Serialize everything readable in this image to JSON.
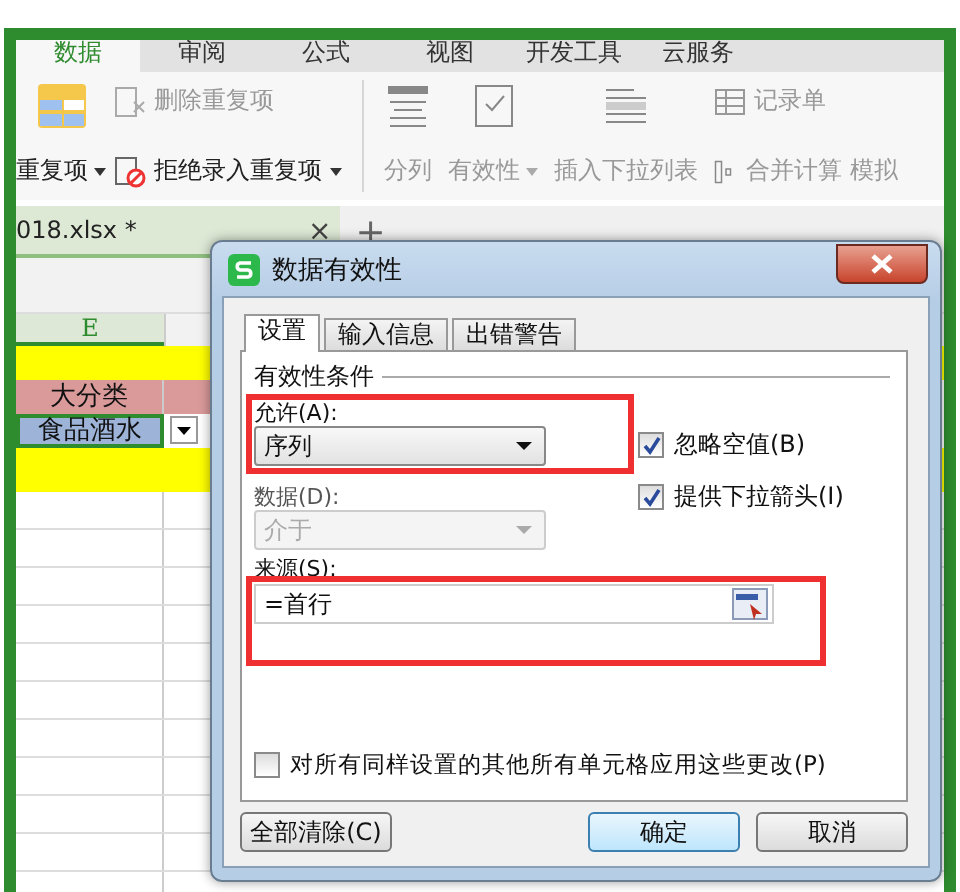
{
  "ribbon_tabs": [
    {
      "label": "数据",
      "selected": true
    },
    {
      "label": "审阅",
      "selected": false
    },
    {
      "label": "公式",
      "selected": false
    },
    {
      "label": "视图",
      "selected": false
    },
    {
      "label": "开发工具",
      "selected": false
    },
    {
      "label": "云服务",
      "selected": false
    }
  ],
  "ribbon": {
    "left": [
      {
        "label": "删除重复项",
        "disabled": true,
        "dropdown": false
      },
      {
        "label": "拒绝录入重复项",
        "disabled": false,
        "dropdown": true
      }
    ],
    "big": {
      "label": "重复项",
      "dropdown": true
    },
    "tools": [
      {
        "label": "分列",
        "kind": "split",
        "dropdown": false
      },
      {
        "label": "有效性",
        "kind": "check",
        "dropdown": true
      },
      {
        "label": "插入下拉列表",
        "kind": "list",
        "dropdown": false
      }
    ],
    "small": [
      {
        "label": "记录单",
        "kind": "form"
      },
      {
        "label": "合并计算",
        "kind": "merge"
      }
    ],
    "cut_label": "模拟"
  },
  "file_tab": {
    "name": "018.xlsx *",
    "close": "×",
    "add": "+"
  },
  "sheet": {
    "column": "E",
    "header_cell": "大分类",
    "active_cell": "食品酒水"
  },
  "dialog": {
    "title": "数据有效性",
    "tabs": [
      {
        "label": "设置",
        "selected": true
      },
      {
        "label": "输入信息",
        "selected": false
      },
      {
        "label": "出错警告",
        "selected": false
      }
    ],
    "section": "有效性条件",
    "allow": {
      "label": "允许(A):",
      "value": "序列",
      "disabled": false
    },
    "data": {
      "label": "数据(D):",
      "value": "介于",
      "disabled": true
    },
    "checks": [
      {
        "label": "忽略空值(B)",
        "checked": true
      },
      {
        "label": "提供下拉箭头(I)",
        "checked": true
      }
    ],
    "source": {
      "label": "来源(S):",
      "value": "=首行"
    },
    "apply_all": {
      "label": "对所有同样设置的其他所有单元格应用这些更改(P)",
      "checked": false
    },
    "buttons": [
      {
        "label": "全部清除(C)",
        "kind": "clear"
      },
      {
        "label": "确定",
        "kind": "ok"
      },
      {
        "label": "取消",
        "kind": "cancel"
      }
    ]
  }
}
